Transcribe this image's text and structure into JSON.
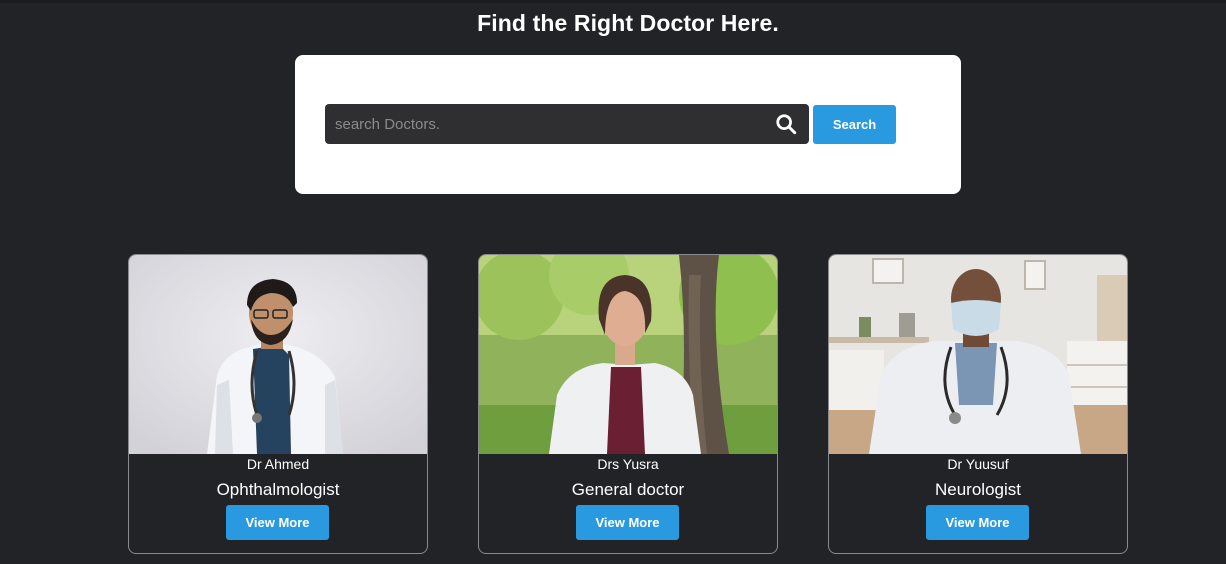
{
  "header": {
    "title": "Find the Right Doctor Here."
  },
  "search": {
    "placeholder": "search Doctors.",
    "value": "",
    "button_label": "Search",
    "icon": "search-icon"
  },
  "doctors": [
    {
      "name": "Dr Ahmed",
      "specialty": "Ophthalmologist",
      "button_label": "View More"
    },
    {
      "name": "Drs Yusra",
      "specialty": "General doctor",
      "button_label": "View More"
    },
    {
      "name": "Dr Yuusuf",
      "specialty": "Neurologist",
      "button_label": "View More"
    }
  ],
  "colors": {
    "background": "#222327",
    "accent": "#2a9ae0",
    "panel": "#ffffff",
    "input": "#2f2f31"
  }
}
